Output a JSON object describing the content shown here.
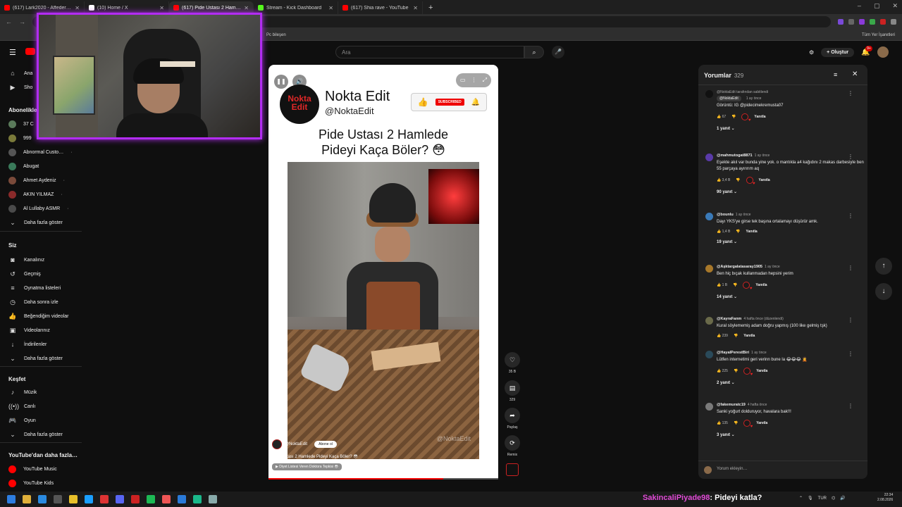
{
  "browser": {
    "tabs": [
      {
        "title": "(617) Lark2020 - Affedersin (Of",
        "color": "#ff0000",
        "active": false
      },
      {
        "title": "(10) Home / X",
        "color": "#ffffff",
        "active": false
      },
      {
        "title": "(617) Pide Ustası 2 Hamlede",
        "color": "#ff0000",
        "active": true
      },
      {
        "title": "Stream - Kick Dashboard",
        "color": "#53fc18",
        "active": false
      },
      {
        "title": "(617) Shia rave - YouTube",
        "color": "#ff0000",
        "active": false
      }
    ],
    "bookmarks": [
      "Pc bileşen",
      "Tüm Yer İşaretleri"
    ]
  },
  "youtube": {
    "search_placeholder": "Ara",
    "create_label": "Oluştur",
    "notification_count": "9+"
  },
  "sidebar": {
    "top_items": [
      {
        "label": "Ana",
        "icon": "home-icon"
      },
      {
        "label": "Sho",
        "icon": "shorts-icon"
      }
    ],
    "subscriptions_heading": "Abonelikler",
    "subscriptions": [
      {
        "label": "37 C",
        "color": "#5a7a5a"
      },
      {
        "label": "999",
        "color": "#7a7a3a"
      },
      {
        "label": "Abnormal Custo…",
        "color": "#555555"
      },
      {
        "label": "Abugat",
        "color": "#3a7a5a"
      },
      {
        "label": "Ahmet Aydeniz",
        "color": "#7a4a3a"
      },
      {
        "label": "AKIN YILMAZ",
        "color": "#8a2a2a"
      },
      {
        "label": "Al Lullaby ASMR",
        "color": "#4a4a4a"
      }
    ],
    "show_more": "Daha fazla göster",
    "you_heading": "Siz",
    "you_items": [
      {
        "label": "Kanalınız",
        "icon": "channel-icon"
      },
      {
        "label": "Geçmiş",
        "icon": "history-icon"
      },
      {
        "label": "Oynatma listeleri",
        "icon": "playlist-icon"
      },
      {
        "label": "Daha sonra izle",
        "icon": "clock-icon"
      },
      {
        "label": "Beğendiğim videolar",
        "icon": "like-icon"
      },
      {
        "label": "Videolarınız",
        "icon": "video-icon"
      },
      {
        "label": "İndirilenler",
        "icon": "download-icon"
      },
      {
        "label": "Daha fazla göster",
        "icon": "chevron-down-icon"
      }
    ],
    "explore_heading": "Keşfet",
    "explore_items": [
      {
        "label": "Müzik",
        "icon": "music-icon"
      },
      {
        "label": "Canlı",
        "icon": "live-icon"
      },
      {
        "label": "Oyun",
        "icon": "gaming-icon"
      },
      {
        "label": "Daha fazla göster",
        "icon": "chevron-down-icon"
      }
    ],
    "more_heading": "YouTube'dan daha fazla…",
    "more_items": [
      {
        "label": "YouTube Music"
      },
      {
        "label": "YouTube Kids"
      }
    ]
  },
  "short": {
    "brand_logo_text": "Nokta Edit",
    "brand_name": "Nokta Edit",
    "brand_handle": "@NoktaEdit",
    "subscribed_label": "SUBSCRIBED",
    "title_line1": "Pide Ustası 2 Hamlede",
    "title_line2": "Pideyi Kaça Böler? 😳",
    "watermark": "@NoktaEdit",
    "channel": "@NoktaEdit",
    "subscribe_label": "Abone ol",
    "caption": "Pide Ustası 2 Hamlede Pideyi Kaça Böler? 😳",
    "playlist": "▶ Diyet Listesi Veren Doktora Tepkisi 😳",
    "progress": 0.76
  },
  "actions": {
    "likes": "35 B",
    "comments": "329",
    "share": "Paylaş",
    "remix": "Remix"
  },
  "comments": {
    "title": "Yorumlar",
    "count": "329",
    "input_placeholder": "Yorum ekleyin…",
    "items": [
      {
        "pinned": "@NoktaEdit tarafından sabitlendi",
        "user": "@NoktaEdit",
        "time": "1 ay önce",
        "text": "Görüntü: IG @pidecimekremusta07",
        "likes": "67",
        "reply": "Yanıtla",
        "replies": "1 yanıt",
        "av": "#111111"
      },
      {
        "user": "@mahmutogat8871",
        "time": "1 ay önce",
        "text": "Eşekte akıl var bunda yine yok. o mantıkla a4 kağıdını 2 makas darbesiyle ben 55 parçaya ayırırım aq",
        "likes": "3,4 B",
        "reply": "Yanıtla",
        "replies": "90 yanıt",
        "av": "#5a3aa8"
      },
      {
        "user": "@bounlu",
        "time": "1 ay önce",
        "text": "Dayı YKS'ye girse tek başına ortalamayı düşürür amk.",
        "likes": "1,4 B",
        "reply": "Yanıtla",
        "replies": "19 yanıt",
        "av": "#3a7ab8"
      },
      {
        "user": "@Aşktargalatasaray1905",
        "time": "1 ay önce",
        "text": "Ben hiç bıçak kullanmadan hepsini yerim",
        "likes": "1 B",
        "reply": "Yanıtla",
        "replies": "14 yanıt",
        "av": "#a8782a"
      },
      {
        "user": "@KayraFanm",
        "time": "4 hafta önce (düzenlendi)",
        "text": "Kural söylememiş adam doğru yapmış (100 like gelmiş tşk)",
        "likes": "239",
        "reply": "Yanıtla",
        "replies": "",
        "av": "#6a6a4a"
      },
      {
        "user": "@HayalPerestBiri",
        "time": "1 ay önce",
        "text": "Lütfen internetimi geri verinn bune la 😂😂😂 🤦",
        "likes": "225",
        "reply": "Yanıtla",
        "replies": "2 yanıt",
        "av": "#2a4a5a"
      },
      {
        "user": "@fakemuratc19",
        "time": "4 hafta önce",
        "text": "Sanki yoğurt dolduruyor, havalara bak!!!",
        "likes": "135",
        "reply": "Yanıtla",
        "replies": "3 yanıt",
        "av": "#7a7a7a"
      }
    ]
  },
  "taskbar": {
    "chat_user": "SakincaliPiyade98",
    "chat_message": ": Pideyi katla?",
    "lang": "TUR",
    "time": "22:34",
    "date": "2.08.2026"
  }
}
